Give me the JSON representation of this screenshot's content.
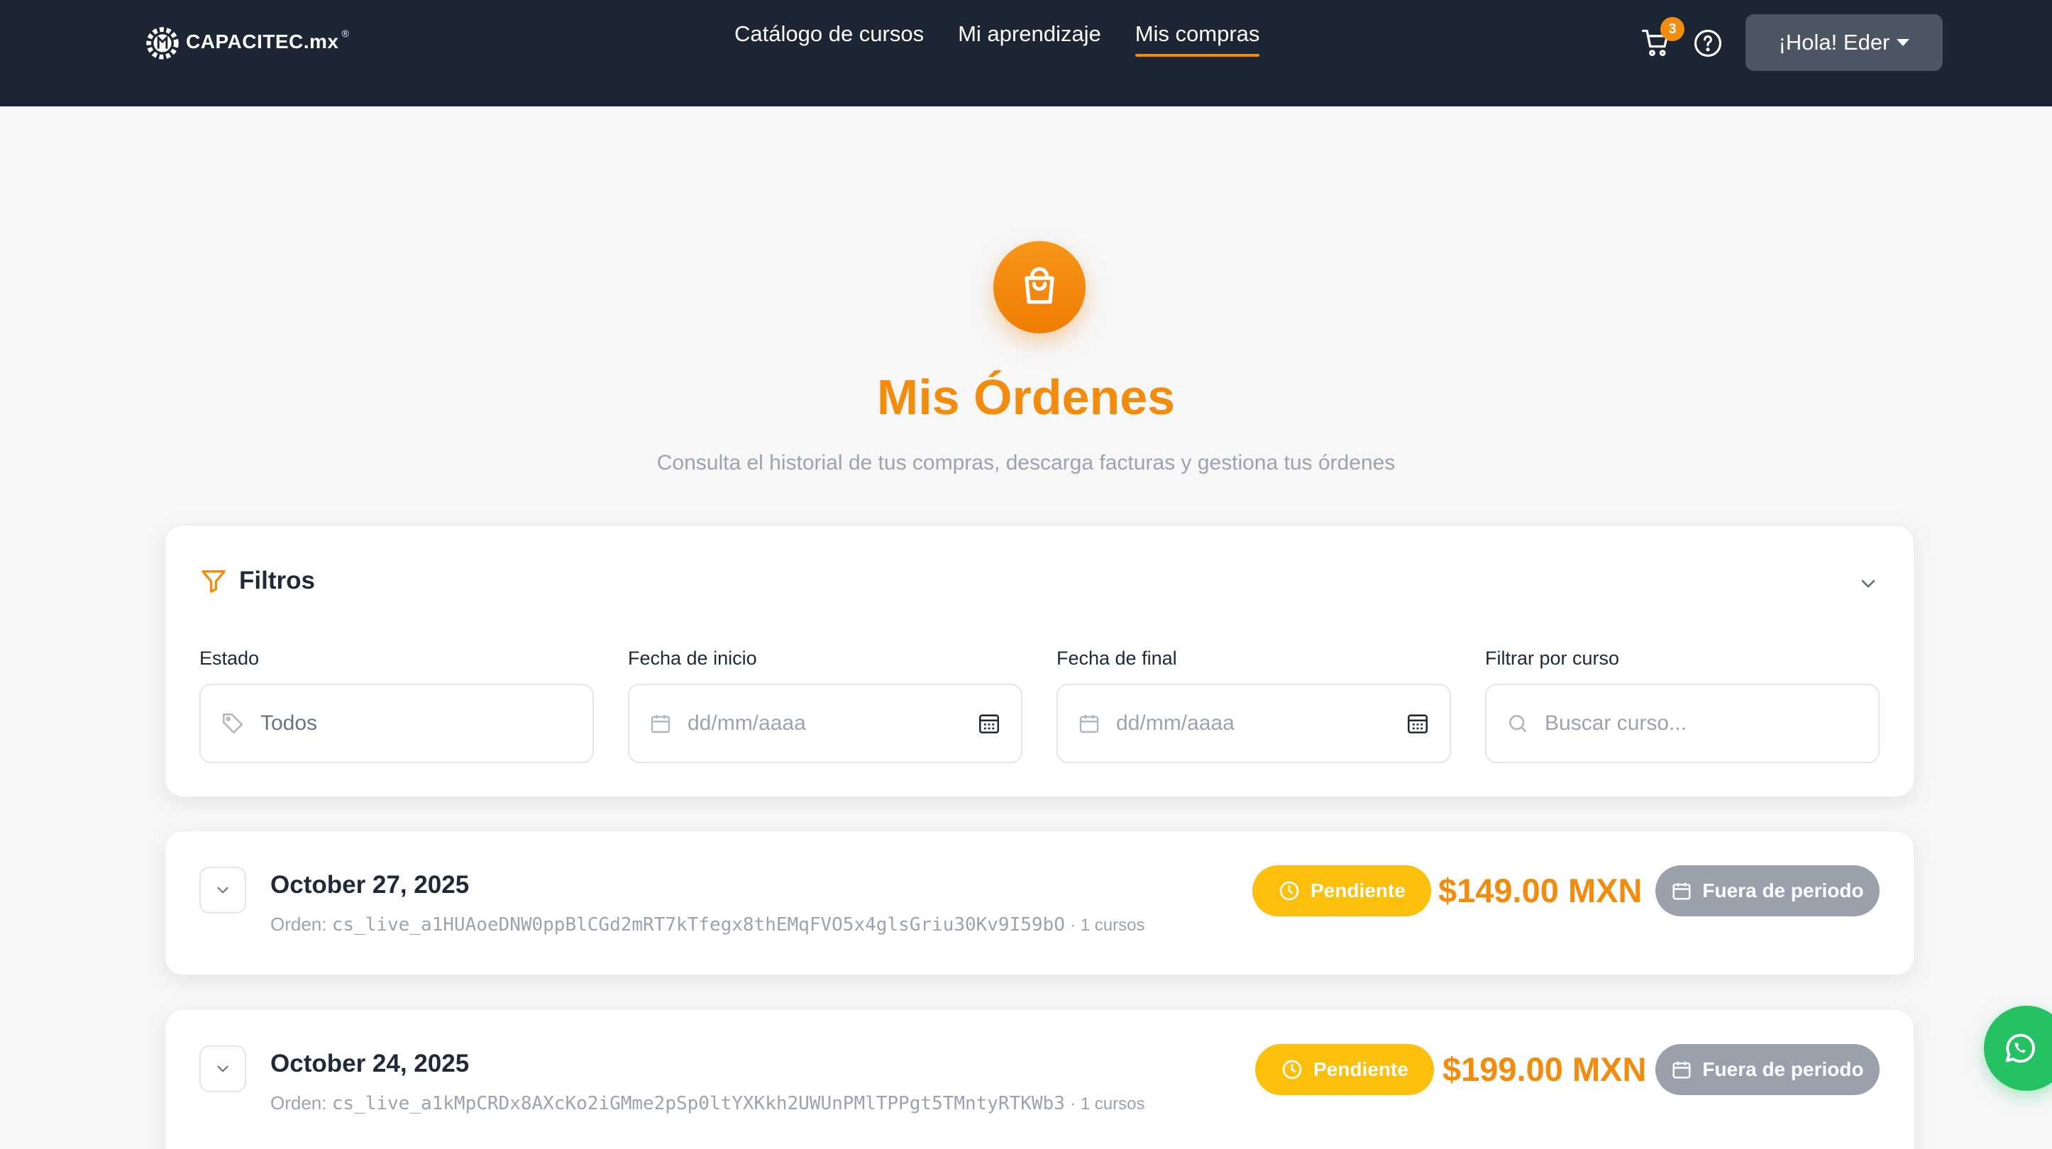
{
  "brand": {
    "name": "CAPACITEC.mx",
    "reg": "®"
  },
  "nav": {
    "links": [
      {
        "label": "Catálogo de cursos",
        "active": false
      },
      {
        "label": "Mi aprendizaje",
        "active": false
      },
      {
        "label": "Mis compras",
        "active": true
      }
    ],
    "cart_count": "3",
    "user_label": "¡Hola! Eder"
  },
  "hero": {
    "icon": "shopping-bag-icon",
    "title": "Mis Órdenes",
    "subtitle": "Consulta el historial de tus compras, descarga facturas y gestiona tus órdenes"
  },
  "filters": {
    "title": "Filtros",
    "fields": [
      {
        "label": "Estado",
        "value": "Todos",
        "icon": "tag-icon"
      },
      {
        "label": "Fecha de inicio",
        "placeholder": "dd/mm/aaaa",
        "icon": "calendar-icon"
      },
      {
        "label": "Fecha de final",
        "placeholder": "dd/mm/aaaa",
        "icon": "calendar-icon"
      },
      {
        "label": "Filtrar por curso",
        "placeholder": "Buscar curso...",
        "icon": "search-icon"
      }
    ]
  },
  "orders": [
    {
      "date": "October 27, 2025",
      "order_prefix": "Orden:",
      "order_id": "cs_live_a1HUAoeDNW0ppBlCGd2mRT7kTfegx8thEMqFVO5x4glsGriu30Kv9I59bO",
      "courses": "· 1 cursos",
      "status": "Pendiente",
      "price": "$149.00 MXN",
      "period": "Fuera de periodo"
    },
    {
      "date": "October 24, 2025",
      "order_prefix": "Orden:",
      "order_id": "cs_live_a1kMpCRDx8AXcKo2iGMme2pSp0ltYXKkh2UWUnPMlTPPgt5TMntyRTKWb3",
      "courses": "· 1 cursos",
      "status": "Pendiente",
      "price": "$199.00 MXN",
      "period": "Fuera de periodo"
    }
  ],
  "colors": {
    "navbar": "#1c2533",
    "accent": "#f28c0e",
    "pending": "#fbbf0c",
    "period": "#9ba1ac",
    "whatsapp": "#25c263"
  }
}
